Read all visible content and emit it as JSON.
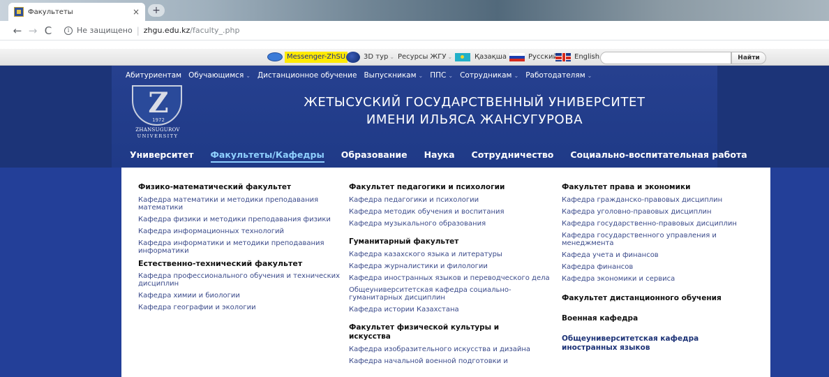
{
  "browser": {
    "tab_title": "Факультеты",
    "tab_close": "×",
    "new_tab": "+",
    "back": "←",
    "forward": "→",
    "reload": "C",
    "info": "i",
    "not_secure": "Не защищено",
    "separator": "|",
    "url_host": "zhgu.edu.kz",
    "url_path": "/faculty_.php"
  },
  "topstrip": {
    "messenger": "Messenger-ZhSU",
    "tour": "3D тур",
    "resources": "Ресурсы ЖГУ",
    "kazakh": "Қазақша",
    "russian": "Русский",
    "english": "English",
    "search_button": "Найти",
    "search_value": "",
    "dropdown_glyph": "⌄"
  },
  "header": {
    "upnav": [
      "Абитуриентам",
      "Обучающимся",
      "Дистанционное обучение",
      "Выпускникам",
      "ППС",
      "Сотрудникам",
      "Работодателям"
    ],
    "logo": {
      "letter": "Z",
      "year": "1972",
      "line1": "ZHANSUGUROV",
      "line2": "UNIVERSITY"
    },
    "title_line1": "ЖЕТЫСУСКИЙ ГОСУДАРСТВЕННЫЙ УНИВЕРСИТЕТ",
    "title_line2": "ИМЕНИ ИЛЬЯСА ЖАНСУГУРОВА",
    "mainnav": [
      "Университет",
      "Факультеты/Кафедры",
      "Образование",
      "Наука",
      "Сотрудничество",
      "Социально-воспитательная работа"
    ],
    "active_item": "Факультеты/Кафедры"
  },
  "colors": {
    "header_blue": "#1f3a87",
    "active_nav": "#8fd0ff",
    "messenger_highlight": "#ffea00",
    "link": "#3a4a8a"
  },
  "columns": {
    "col1": {
      "fac1": "Физико-математический факультет",
      "fac1_depts": [
        "Кафедра математики и методики преподавания математики",
        "Кафедра физики и методики преподавания физики",
        "Кафедра информационных технологий",
        "Кафедра информатики и методики преподавания информатики"
      ],
      "fac2": "Естественно-технический факультет",
      "fac2_depts": [
        "Кафедра профессионального обучения и технических дисциплин",
        "Кафедра химии и биологии",
        "Кафедра географии и экологии"
      ]
    },
    "col2": {
      "fac1": "Факультет педагогики и психологии",
      "fac1_depts": [
        "Кафедра педагогики и психологии",
        "Кафедра методик обучения и воспитания",
        "Кафедра музыкального образования"
      ],
      "fac2": "Гуманитарный факультет",
      "fac2_depts": [
        "Кафедра казахского языка и литературы",
        "Кафедра журналистики и филологии",
        "Кафедра иностранных языков и переводческого дела",
        "Общеуниверситетская кафедра социально-гуманитарных дисциплин",
        "Кафедра истории Казахстана"
      ],
      "fac3": "Факультет физической культуры и искусства",
      "fac3_depts": [
        "Кафедра изобразительного искусства и дизайна",
        "Кафедра начальной военной подготовки и"
      ]
    },
    "col3": {
      "fac1": "Факультет права и экономики",
      "fac1_depts": [
        "Кафедра гражданско-правовых дисциплин",
        "Кафедра уголовно-правовых дисциплин",
        "Кафедра государственно-правовых дисциплин",
        "Кафедра государственного управления и менеджмента",
        "Кафеда учета и финансов",
        "Кафедра финансов",
        "Кафедра экономики и сервиса"
      ],
      "fac2": "Факультет дистанционного обучения",
      "fac3": "Военная кафедра",
      "fac4": "Общеуниверситетская кафедра иностранных языков"
    }
  }
}
